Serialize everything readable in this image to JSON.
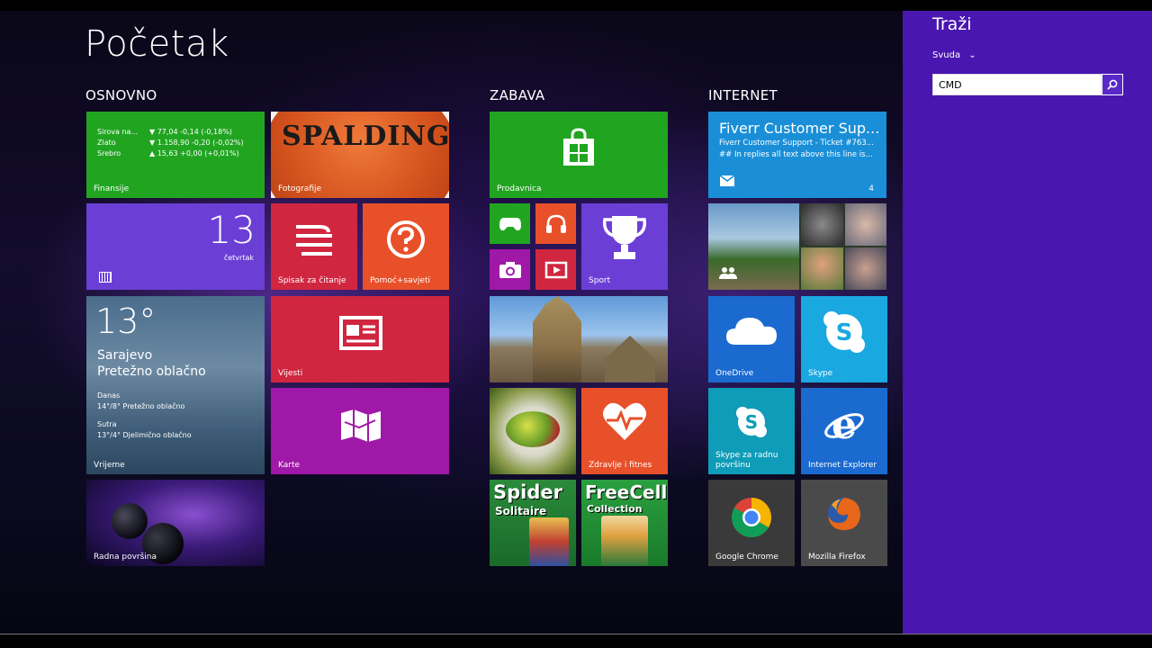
{
  "start": {
    "title": "Početak"
  },
  "groups": {
    "osnovno": "OSNOVNO",
    "zabava": "ZABAVA",
    "internet": "INTERNET"
  },
  "colors": {
    "accent_panel": "#4a16b0",
    "green": "#21a521",
    "purple": "#6b3fd6",
    "red": "#d12640",
    "orange": "#e8502a",
    "magenta": "#a018a8",
    "blue": "#1a8fd8",
    "cyan": "#1aa8e0"
  },
  "tiles": {
    "finansije": {
      "label": "Finansije",
      "rows": [
        {
          "name": "Sirova na...",
          "value": "▼ 77,04 -0,14 (-0,18%)"
        },
        {
          "name": "Zlato",
          "value": "▼ 1.158,90 -0,20 (-0,02%)"
        },
        {
          "name": "Srebro",
          "value": "▲ 15,63 +0,00 (+0,01%)"
        }
      ]
    },
    "fotografije": {
      "label": "Fotografije",
      "ball_text": "SPALDING"
    },
    "kalendar": {
      "day": "13",
      "weekday": "četvrtak",
      "icon": "calendar-icon"
    },
    "spisak": {
      "label": "Spisak za čitanje",
      "icon": "reading-list-icon"
    },
    "pomoc": {
      "label": "Pomoć+savjeti",
      "icon": "help-icon"
    },
    "vrijeme": {
      "label": "Vrijeme",
      "temp": "13°",
      "city": "Sarajevo",
      "condition": "Pretežno oblačno",
      "today_label": "Danas",
      "today": "14°/8° Pretežno oblačno",
      "tomorrow_label": "Sutra",
      "tomorrow": "13°/4° Djelimično oblačno"
    },
    "vijesti": {
      "label": "Vijesti",
      "icon": "news-icon"
    },
    "karte": {
      "label": "Karte",
      "icon": "maps-icon"
    },
    "radna": {
      "label": "Radna površina"
    },
    "prodavnica": {
      "label": "Prodavnica",
      "icon": "store-icon"
    },
    "sport": {
      "label": "Sport",
      "icon": "trophy-icon"
    },
    "zdravlje": {
      "label": "Zdravlje i fitnes",
      "icon": "heart-pulse-icon"
    },
    "spider": {
      "line1": "Spider",
      "line2": "Solitaire"
    },
    "freecell": {
      "line1": "FreeCell",
      "line2": "Collection"
    },
    "mail": {
      "title": "Fiverr Customer Sup...",
      "line1": "Fiverr Customer Support - Ticket #763...",
      "line2": "## In replies all text above this line is...",
      "count": "4",
      "icon": "mail-icon"
    },
    "onedrive": {
      "label": "OneDrive",
      "icon": "cloud-icon"
    },
    "skype": {
      "label": "Skype",
      "icon": "skype-icon"
    },
    "skype_desktop": {
      "label": "Skype za radnu površinu",
      "icon": "skype-icon"
    },
    "ie": {
      "label": "Internet Explorer",
      "icon": "ie-icon"
    },
    "chrome": {
      "label": "Google Chrome",
      "icon": "chrome-icon"
    },
    "firefox": {
      "label": "Mozilla Firefox",
      "icon": "firefox-icon"
    }
  },
  "search": {
    "title": "Traži",
    "scope": "Svuda",
    "value": "CMD",
    "button_icon": "search-icon"
  }
}
